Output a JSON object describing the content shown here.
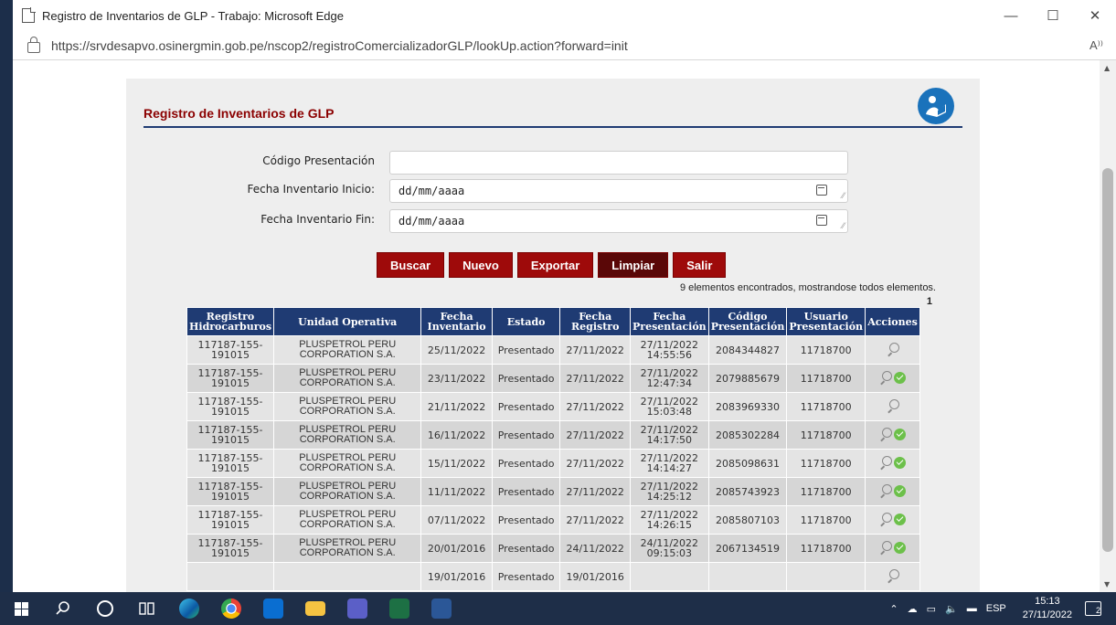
{
  "window": {
    "title": "Registro de Inventarios de GLP - Trabajo: Microsoft Edge",
    "url": "https://srvdesapvo.osinergmin.gob.pe/nscop2/registroComercializadorGLP/lookUp.action?forward=init",
    "minimize": "—",
    "maximize": "☐",
    "close": "✕",
    "read_aloud": "A⁾⁾"
  },
  "page": {
    "title": "Registro de Inventarios de GLP"
  },
  "form": {
    "codigo_label": "Código Presentación",
    "codigo_value": "",
    "fecha_inicio_label": "Fecha Inventario Inicio:",
    "fecha_inicio_value": "dd/mm/aaaa",
    "fecha_fin_label": "Fecha Inventario Fin:",
    "fecha_fin_value": "dd/mm/aaaa"
  },
  "buttons": {
    "buscar": "Buscar",
    "nuevo": "Nuevo",
    "exportar": "Exportar",
    "limpiar": "Limpiar",
    "salir": "Salir"
  },
  "results": {
    "summary": "9 elementos encontrados, mostrandose todos elementos.",
    "page": "1"
  },
  "table": {
    "headers": [
      "Registro Hidrocarburos",
      "Unidad Operativa",
      "Fecha Inventario",
      "Estado",
      "Fecha Registro",
      "Fecha Presentación",
      "Código Presentación",
      "Usuario Presentación",
      "Acciones"
    ],
    "rows": [
      {
        "registro": "117187-155-191015",
        "unidad": "PLUSPETROL PERU CORPORATION S.A.",
        "fecha_inv": "25/11/2022",
        "estado": "Presentado",
        "fecha_reg": "27/11/2022",
        "fecha_pres": "27/11/2022 14:55:56",
        "codigo": "2084344827",
        "usuario": "11718700",
        "actions": [
          "view"
        ]
      },
      {
        "registro": "117187-155-191015",
        "unidad": "PLUSPETROL PERU CORPORATION S.A.",
        "fecha_inv": "23/11/2022",
        "estado": "Presentado",
        "fecha_reg": "27/11/2022",
        "fecha_pres": "27/11/2022 12:47:34",
        "codigo": "2079885679",
        "usuario": "11718700",
        "actions": [
          "view",
          "ok"
        ]
      },
      {
        "registro": "117187-155-191015",
        "unidad": "PLUSPETROL PERU CORPORATION S.A.",
        "fecha_inv": "21/11/2022",
        "estado": "Presentado",
        "fecha_reg": "27/11/2022",
        "fecha_pres": "27/11/2022 15:03:48",
        "codigo": "2083969330",
        "usuario": "11718700",
        "actions": [
          "view"
        ]
      },
      {
        "registro": "117187-155-191015",
        "unidad": "PLUSPETROL PERU CORPORATION S.A.",
        "fecha_inv": "16/11/2022",
        "estado": "Presentado",
        "fecha_reg": "27/11/2022",
        "fecha_pres": "27/11/2022 14:17:50",
        "codigo": "2085302284",
        "usuario": "11718700",
        "actions": [
          "view",
          "ok"
        ]
      },
      {
        "registro": "117187-155-191015",
        "unidad": "PLUSPETROL PERU CORPORATION S.A.",
        "fecha_inv": "15/11/2022",
        "estado": "Presentado",
        "fecha_reg": "27/11/2022",
        "fecha_pres": "27/11/2022 14:14:27",
        "codigo": "2085098631",
        "usuario": "11718700",
        "actions": [
          "view",
          "ok"
        ]
      },
      {
        "registro": "117187-155-191015",
        "unidad": "PLUSPETROL PERU CORPORATION S.A.",
        "fecha_inv": "11/11/2022",
        "estado": "Presentado",
        "fecha_reg": "27/11/2022",
        "fecha_pres": "27/11/2022 14:25:12",
        "codigo": "2085743923",
        "usuario": "11718700",
        "actions": [
          "view",
          "ok"
        ]
      },
      {
        "registro": "117187-155-191015",
        "unidad": "PLUSPETROL PERU CORPORATION S.A.",
        "fecha_inv": "07/11/2022",
        "estado": "Presentado",
        "fecha_reg": "27/11/2022",
        "fecha_pres": "27/11/2022 14:26:15",
        "codigo": "2085807103",
        "usuario": "11718700",
        "actions": [
          "view",
          "ok"
        ]
      },
      {
        "registro": "117187-155-191015",
        "unidad": "PLUSPETROL PERU CORPORATION S.A.",
        "fecha_inv": "20/01/2016",
        "estado": "Presentado",
        "fecha_reg": "24/11/2022",
        "fecha_pres": "24/11/2022 09:15:03",
        "codigo": "2067134519",
        "usuario": "11718700",
        "actions": [
          "view",
          "ok"
        ]
      },
      {
        "registro": "",
        "unidad": "",
        "fecha_inv": "19/01/2016",
        "estado": "Presentado",
        "fecha_reg": "19/01/2016",
        "fecha_pres": "",
        "codigo": "",
        "usuario": "",
        "actions": [
          "view"
        ]
      }
    ]
  },
  "taskbar": {
    "language": "ESP",
    "time": "15:13",
    "date": "27/11/2022",
    "notifications": "2"
  },
  "colors": {
    "title_red": "#8b0000",
    "button_red": "#9e0a0a",
    "header_blue": "#1f3b73",
    "ok_green": "#6cc04a"
  }
}
